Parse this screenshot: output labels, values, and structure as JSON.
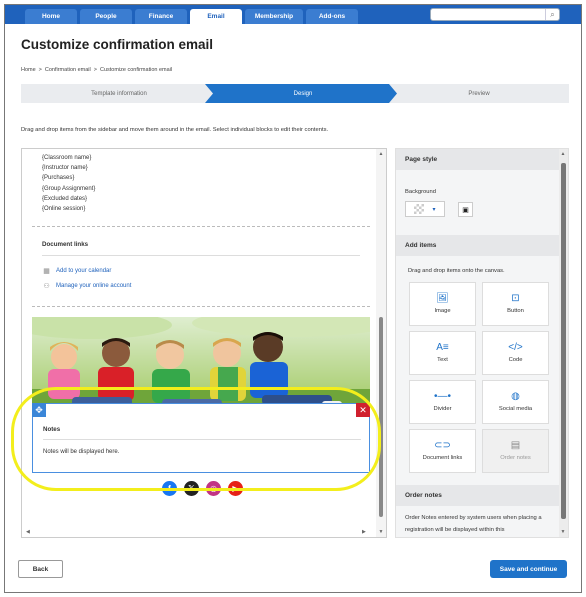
{
  "nav": {
    "tabs": [
      "Home",
      "People",
      "Finance",
      "Email",
      "Membership",
      "Add-ons"
    ],
    "active_tab": "Email",
    "search_icon": "magnifier-icon"
  },
  "page": {
    "title": "Customize confirmation email",
    "breadcrumb": [
      "Home",
      "Confirmation email",
      "Customize confirmation email"
    ],
    "breadcrumb_sep": ">"
  },
  "stepper": {
    "steps": [
      "Template information",
      "Design",
      "Preview"
    ],
    "active_step": "Design"
  },
  "instructions": "Drag and drop items from the sidebar and move them around in the email. Select individual blocks to edit their contents.",
  "canvas": {
    "placeholders": [
      "{Classroom name}",
      "{Instructor name}",
      "{Purchases}",
      "{Group Assignment}",
      "{Excluded dates}",
      "{Online session}"
    ],
    "document_links": {
      "title": "Document links",
      "links": [
        {
          "icon": "calendar-icon",
          "label": "Add to your calendar"
        },
        {
          "icon": "user-account-icon",
          "label": "Manage your online account"
        }
      ]
    },
    "notes": {
      "title": "Notes",
      "text": "Notes will be displayed here.",
      "move_icon": "✥",
      "close_icon": "✕"
    },
    "social": [
      {
        "name": "facebook-icon",
        "glyph": "f",
        "color": "#1877f2"
      },
      {
        "name": "x-icon",
        "glyph": "𝕏",
        "color": "#222222"
      },
      {
        "name": "instagram-icon",
        "glyph": "◎",
        "color": "#c13584"
      },
      {
        "name": "youtube-icon",
        "glyph": "▶",
        "color": "#e62117"
      }
    ]
  },
  "sidebar": {
    "page_style": {
      "title": "Page style",
      "background_label": "Background",
      "select_caret": "▾"
    },
    "add_items": {
      "title": "Add items",
      "description": "Drag and drop items onto the canvas.",
      "tiles": [
        {
          "label": "Image",
          "icon": "image-icon",
          "glyph": "🖼",
          "disabled": false
        },
        {
          "label": "Button",
          "icon": "button-icon",
          "glyph": "⊡",
          "disabled": false
        },
        {
          "label": "Text",
          "icon": "text-icon",
          "glyph": "A≡",
          "disabled": false
        },
        {
          "label": "Code",
          "icon": "code-icon",
          "glyph": "</>",
          "disabled": false
        },
        {
          "label": "Divider",
          "icon": "divider-icon",
          "glyph": "•—•",
          "disabled": false
        },
        {
          "label": "Social media",
          "icon": "social-media-icon",
          "glyph": "◍",
          "disabled": false
        },
        {
          "label": "Document links",
          "icon": "link-icon",
          "glyph": "⊂⊃",
          "disabled": false
        },
        {
          "label": "Order notes",
          "icon": "notes-icon",
          "glyph": "▤",
          "disabled": true
        }
      ]
    },
    "order_notes": {
      "title": "Order notes",
      "text": "Order Notes entered by system users when placing a registration will be displayed within this"
    }
  },
  "footer": {
    "back_label": "Back",
    "save_label": "Save and continue"
  },
  "colors": {
    "nav_blue": "#1f62bc",
    "accent_blue": "#1f73c9",
    "highlight_yellow": "#f3ee1c",
    "close_red": "#d0202e"
  }
}
